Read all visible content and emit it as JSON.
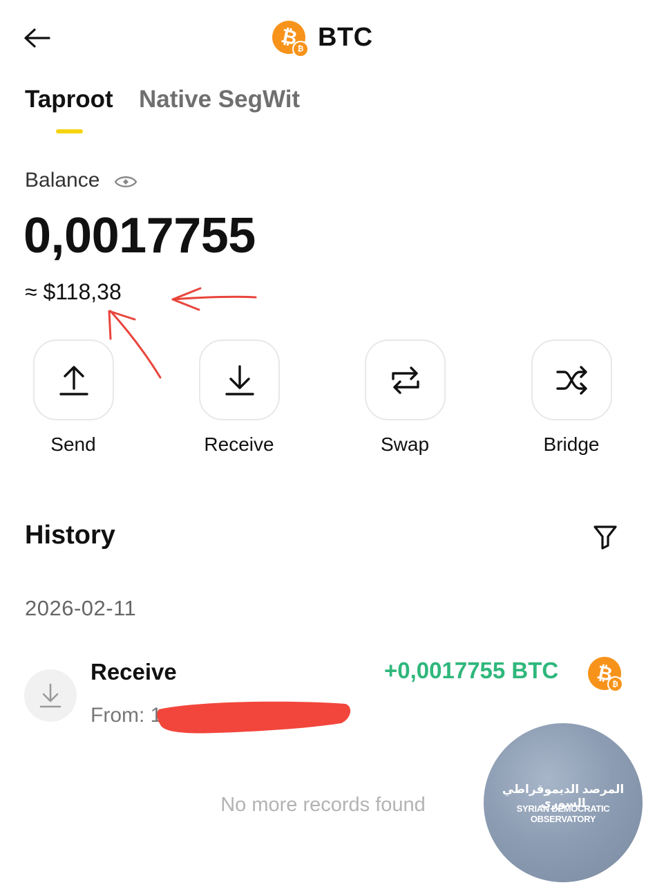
{
  "header": {
    "title": "BTC",
    "coin_symbol": "₿",
    "back_icon": "arrow-left-icon"
  },
  "tabs": [
    {
      "label": "Taproot",
      "active": true
    },
    {
      "label": "Native SegWit",
      "active": false
    }
  ],
  "balance": {
    "label": "Balance",
    "value": "0,0017755",
    "fiat": "≈ $118,38"
  },
  "actions": [
    {
      "label": "Send",
      "icon": "upload-icon"
    },
    {
      "label": "Receive",
      "icon": "download-icon"
    },
    {
      "label": "Swap",
      "icon": "swap-icon"
    },
    {
      "label": "Bridge",
      "icon": "shuffle-icon"
    }
  ],
  "history": {
    "title": "History",
    "groups": [
      {
        "date": "2026-02-11",
        "items": [
          {
            "type": "Receive",
            "amount": "+0,0017755 BTC",
            "from_label": "From:",
            "from_value_visible": "1"
          }
        ]
      }
    ],
    "end_text": "No more records found"
  },
  "watermark": {
    "arabic": "المرصد الديموقراطي السوري",
    "english": "SYRIAN DEMOCRATIC OBSERVATORY"
  },
  "colors": {
    "accent": "#f5d410",
    "btc_orange": "#f7931a",
    "positive": "#2fb77c",
    "annotation_red": "#e8453c"
  }
}
